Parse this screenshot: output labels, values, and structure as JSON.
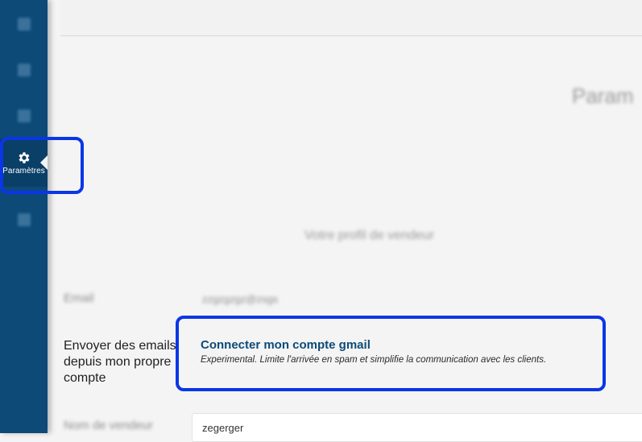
{
  "sidebar": {
    "items": [
      {
        "icon": "blurred-icon",
        "label": ""
      },
      {
        "icon": "blurred-icon",
        "label": ""
      },
      {
        "icon": "blurred-icon",
        "label": ""
      },
      {
        "icon": "gear-icon",
        "label": "Paramètres",
        "active": true
      },
      {
        "icon": "blurred-icon",
        "label": ""
      }
    ],
    "color": "#0d4a78"
  },
  "page": {
    "title": "Param"
  },
  "profile": {
    "section_title": "Votre profil de vendeur",
    "email_label": "Email",
    "email_value": "zzgzgzgz@zsgs",
    "send_label": "Envoyer des emails depuis mon propre compte",
    "connect_link": "Connecter mon compte gmail",
    "connect_note": "Experimental. Limite l'arrivée en spam et simplifie la communication avec les clients.",
    "vendor_label": "Nom de vendeur",
    "vendor_value": "zegerger"
  },
  "colors": {
    "accent": "#0d4a78",
    "highlight": "#0a36e6"
  }
}
